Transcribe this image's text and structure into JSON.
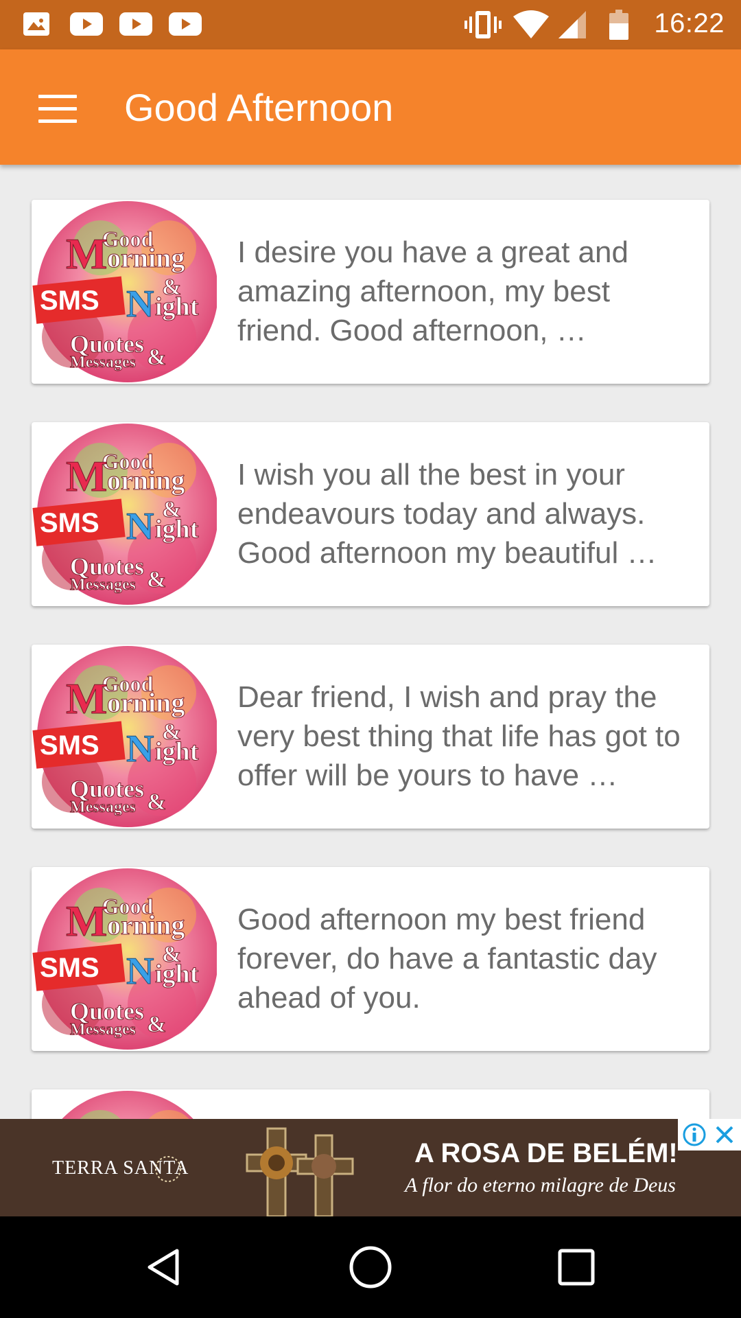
{
  "status_bar": {
    "time": "16:22",
    "notification_icons": [
      "image-icon",
      "youtube-icon",
      "youtube-icon",
      "youtube-icon"
    ],
    "system_icons": [
      "vibrate-icon",
      "wifi-icon",
      "signal-icon",
      "battery-icon"
    ]
  },
  "app_bar": {
    "title": "Good Afternoon",
    "menu_icon": "hamburger-menu-icon",
    "color": "#f5832b"
  },
  "cards": [
    {
      "thumbnail_icon": "sms-app-logo",
      "text": "I desire you have a great and amazing afternoon, my best friend. Good afternoon, …"
    },
    {
      "thumbnail_icon": "sms-app-logo",
      "text": "I wish you all the best in your endeavours today and always. Good afternoon my beautiful …"
    },
    {
      "thumbnail_icon": "sms-app-logo",
      "text": "Dear friend, I wish and pray the very best thing that life has got to offer will be yours to have …"
    },
    {
      "thumbnail_icon": "sms-app-logo",
      "text": "Good afternoon my best friend forever, do have a fantastic day ahead of you."
    },
    {
      "thumbnail_icon": "sms-app-logo",
      "text": ""
    }
  ],
  "ad": {
    "brand": "TERRA SANTA",
    "headline": "A ROSA DE BELÉM!",
    "tagline": "A flor do eterno milagre de Deus",
    "background": "#4a3428"
  },
  "nav_bar": {
    "buttons": [
      "back-icon",
      "home-icon",
      "recent-apps-icon"
    ]
  },
  "colors": {
    "status_bar": "#c4661d",
    "background": "#ececec",
    "card_text": "#6b6b6b"
  }
}
